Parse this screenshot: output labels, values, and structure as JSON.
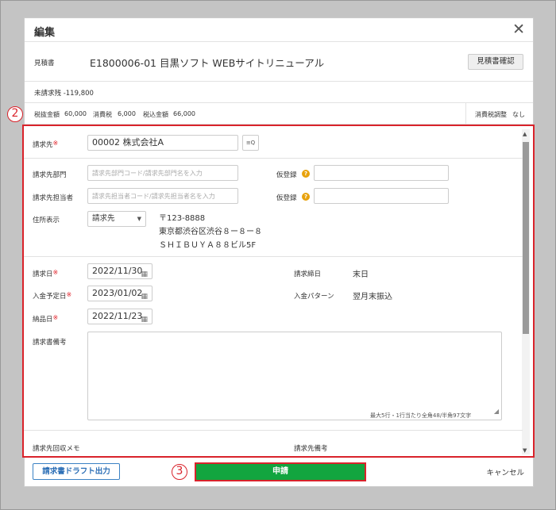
{
  "modal": {
    "title": "編集",
    "close": "✕",
    "estimate_label": "見積書",
    "estimate_text": "E1800006-01 目黒ソフト WEBサイトリニューアル",
    "estimate_button": "見積書確認",
    "unbilled": "未請求残 -119,800",
    "tax_summary": {
      "excl_label": "税抜金額",
      "excl_value": "60,000",
      "tax_label": "消費税",
      "tax_value": "6,000",
      "incl_label": "税込金額",
      "incl_value": "66,000",
      "adjust_label": "消費税調整",
      "adjust_value": "なし"
    }
  },
  "badges": {
    "two": "2",
    "three": "3"
  },
  "form": {
    "billing_to_label": "請求先",
    "billing_to_value": "00002 株式会社A",
    "search_icon_glyph": "≡Q",
    "dept_label": "請求先部門",
    "dept_placeholder": "請求先部門コード/請求先部門名を入力",
    "person_label": "請求先担当者",
    "person_placeholder": "請求先担当者コード/請求先担当者名を入力",
    "temp1_label": "仮登録",
    "temp2_label": "仮登録",
    "address_label": "住所表示",
    "address_select": "請求先",
    "address_lines": [
      "〒123-8888",
      "東京都渋谷区渋谷８ー８ー８",
      "ＳＨＩＢＵＹＡ８８ビル5F"
    ],
    "bill_date_label": "請求日",
    "bill_date": "2022/11/30",
    "closing_label": "請求締日",
    "closing_value": "末日",
    "due_date_label": "入金予定日",
    "due_date": "2023/01/02",
    "pay_pattern_label": "入金パターン",
    "pay_pattern_value": "翌月末振込",
    "delivery_label": "納品日",
    "delivery_date": "2022/11/23",
    "remarks_label": "請求書備考",
    "remarks_hint": "最大5行・1行当たり全角48/半角97文字",
    "memo_label": "請求先回収メモ",
    "client_remarks_label": "請求先備考"
  },
  "footer": {
    "draft_button": "請求書ドラフト出力",
    "apply_button": "申請",
    "cancel": "キャンセル"
  }
}
